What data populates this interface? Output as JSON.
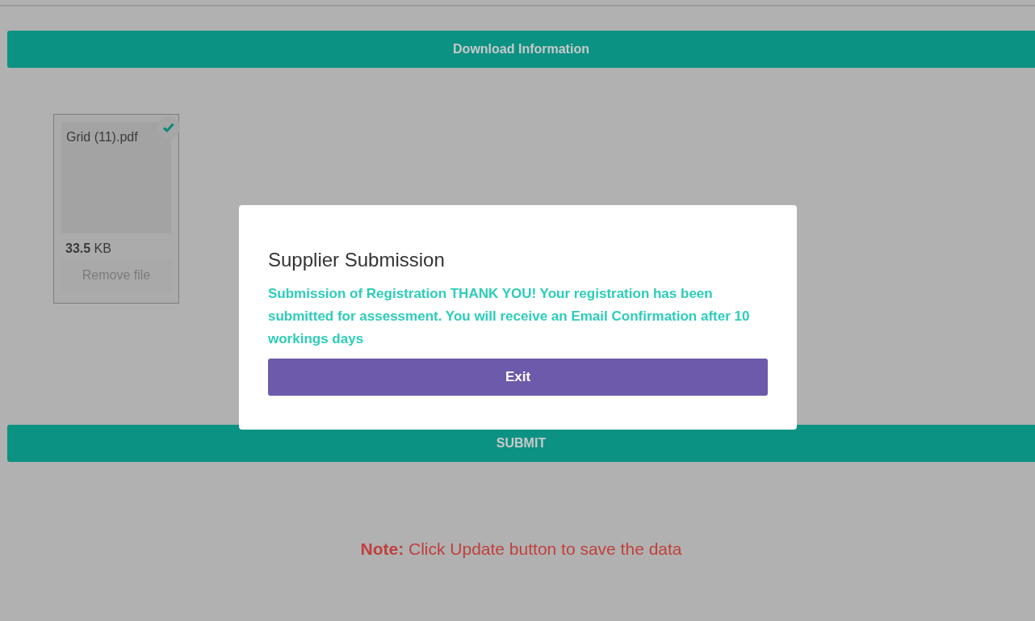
{
  "download_bar": {
    "label": "Download Information"
  },
  "files": [
    {
      "name": "Grid (11).pdf",
      "size": "33.5",
      "unit": "KB",
      "success": true,
      "remove_label": "Remove file"
    }
  ],
  "submit_bar": {
    "label": "SUBMIT"
  },
  "note": "**Note:** Click Update button to save the data",
  "modal": {
    "title": "Supplier Submission",
    "message": "Submission of Registration THANK YOU! Your registration has been submitted for assessment. You will receive an Email Confirmation after 10 workings days",
    "button": "Exit"
  }
}
